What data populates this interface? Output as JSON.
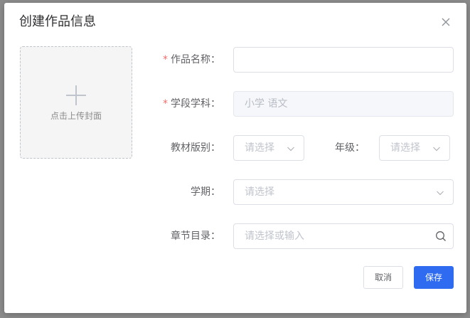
{
  "dialog": {
    "title": "创建作品信息",
    "close_icon": "close-icon"
  },
  "cover": {
    "label": "点击上传封面",
    "icon": "plus-icon"
  },
  "form": {
    "work_name": {
      "label": "作品名称：",
      "required": true,
      "value": "",
      "placeholder": ""
    },
    "stage_subject": {
      "label": "学段学科：",
      "required": true,
      "value": "小学 语文",
      "disabled": true
    },
    "edition": {
      "label": "教材版别：",
      "placeholder": "请选择"
    },
    "grade": {
      "label": "年级：",
      "placeholder": "请选择"
    },
    "semester": {
      "label": "学期：",
      "placeholder": "请选择"
    },
    "chapter": {
      "label": "章节目录：",
      "placeholder": "请选择或输入",
      "icon": "search-icon"
    }
  },
  "buttons": {
    "cancel": "取消",
    "save": "保存"
  },
  "colors": {
    "primary": "#2e6bf0",
    "required_mark": "#f56c6c"
  }
}
